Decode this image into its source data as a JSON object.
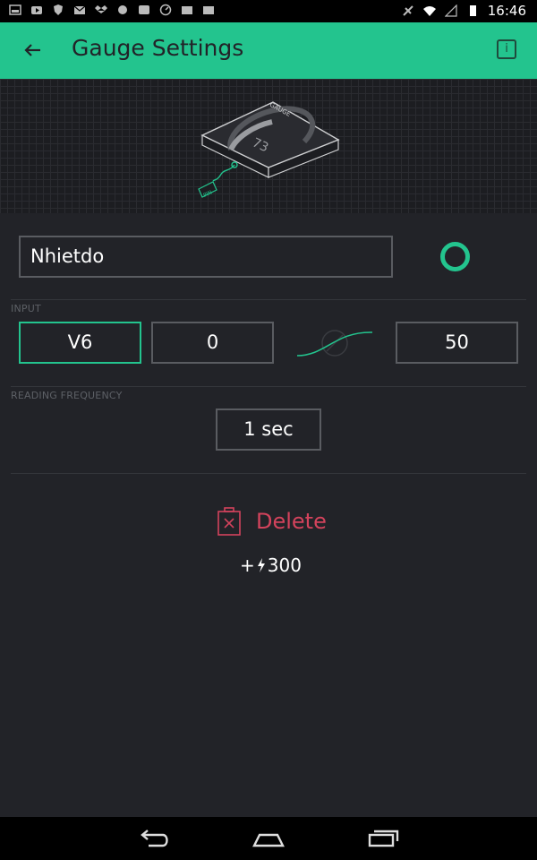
{
  "status_bar": {
    "time": "16:46"
  },
  "app_bar": {
    "title": "Gauge Settings"
  },
  "widget_preview": {
    "gauge_label": "GAUGE",
    "gauge_value": "73",
    "pin_label": "PIN"
  },
  "name_field": {
    "value": "Nhietdo"
  },
  "input_section": {
    "label": "INPUT",
    "pin": "V6",
    "min": "0",
    "max": "50"
  },
  "reading_frequency": {
    "label": "READING FREQUENCY",
    "value": "1 sec"
  },
  "delete": {
    "label": "Delete"
  },
  "cost": {
    "prefix": "+",
    "amount": "300"
  },
  "colors": {
    "accent": "#23c48e",
    "background": "#222328",
    "delete": "#d3435c"
  }
}
